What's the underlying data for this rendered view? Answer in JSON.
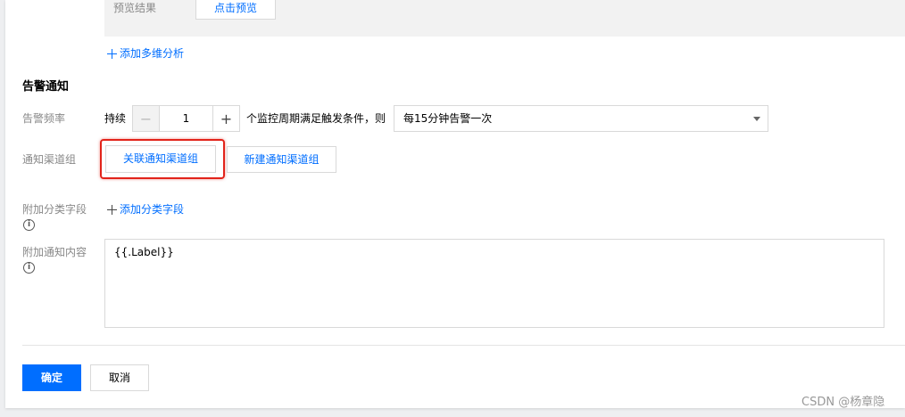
{
  "preview": {
    "label": "预览结果",
    "button": "点击预览"
  },
  "add_multi_analysis": "添加多维分析",
  "alarm_notice": {
    "title": "告警通知",
    "frequency_label": "告警频率",
    "persist_text": "持续",
    "stepper_value": "1",
    "cycle_text": "个监控周期满足触发条件，则",
    "frequency_select": "每15分钟告警一次",
    "channel_group_label": "通知渠道组",
    "link_channel_button": "关联通知渠道组",
    "new_channel_button": "新建通知渠道组",
    "extra_field_label": "附加分类字段",
    "add_field_link": "添加分类字段",
    "extra_content_label": "附加通知内容",
    "extra_content_value": "{{.Label}}"
  },
  "footer": {
    "confirm": "确定",
    "cancel": "取消"
  },
  "watermark": "CSDN @杨章隐",
  "colors": {
    "accent": "#006eff",
    "highlight": "#e2231a"
  },
  "icons": {
    "plus": "plus-icon",
    "minus": "minus-icon",
    "info": "info-icon",
    "caret": "chevron-down-icon"
  }
}
